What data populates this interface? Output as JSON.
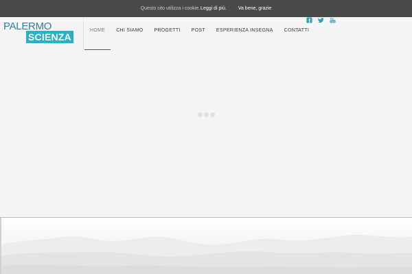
{
  "cookie_bar": {
    "message": "Questo sito utilizza i cookie.",
    "more_link": "Leggi di più.",
    "accept_button": "Va bene, grazie"
  },
  "logo": {
    "line1": "PALERMO",
    "line2": "SCIENZA"
  },
  "nav": {
    "items": [
      {
        "label": "HOME",
        "active": true
      },
      {
        "label": "CHI SIAMO"
      },
      {
        "label": "PROGETTI"
      },
      {
        "label": "POST"
      },
      {
        "label": "ESPERIENZA INSEGNA"
      },
      {
        "label": "CONTATTI"
      }
    ]
  },
  "social": {
    "icons": [
      "facebook-icon",
      "twitter-icon",
      "youtube-icon"
    ],
    "color": "#2a9fb5"
  },
  "colors": {
    "brand_dark": "#2a7fa0",
    "brand_accent": "#2ab0c8",
    "cookie_bar_bg": "#4a4a4a"
  }
}
